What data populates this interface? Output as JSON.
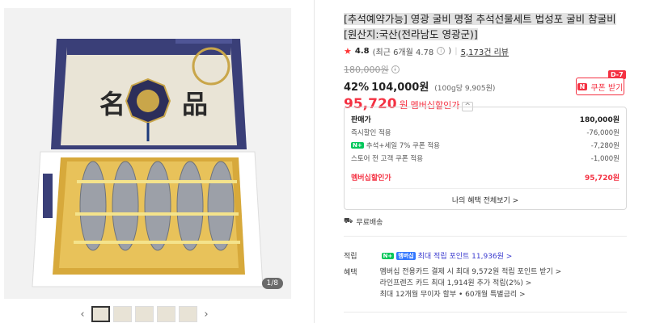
{
  "product": {
    "title": "[추석예약가능] 영광 굴비 명절 추석선물세트 법성포 굴비 참굴비 [원산지:국산(전라남도 영광군)]",
    "rating": "4.8",
    "rating_detail": "(최근 6개월 4.78",
    "rating_info": "i",
    "rating_close": ")",
    "review_count": "5,173건 리뷰",
    "original_price": "180,000원",
    "discount_percent": "42%",
    "discount_price": "104,000원",
    "unit_price": "(100g당 9,905원)",
    "member_price": "95,720",
    "member_won": "원",
    "member_label": "멤버십할인가",
    "image_counter": "1/8"
  },
  "coupon": {
    "badge": "D-7",
    "logo": "N",
    "label": "쿠폰 받기"
  },
  "breakdown": {
    "rows": [
      {
        "label": "판매가",
        "value": "180,000원"
      },
      {
        "label": "즉시할인 적용",
        "value": "-76,000원"
      },
      {
        "label": "추석+세일 7% 쿠폰 적용",
        "value": "-7,280원",
        "badge": "N+"
      },
      {
        "label": "스토어 전 고객 쿠폰 적용",
        "value": "-1,000원"
      },
      {
        "label": "멤버십할인가",
        "value": "95,720원"
      }
    ],
    "link": "나의 혜택 전체보기 >"
  },
  "shipping": {
    "label": "무료배송"
  },
  "points": {
    "label": "적립",
    "badge": "N+",
    "badge2": "멤버십",
    "value": "최대 적립 포인트 11,936원 >"
  },
  "benefits": {
    "label": "혜택",
    "items": [
      "멤버십 전용카드 결제 시 최대 9,572원 적립 포인트 받기 >",
      "라인프렌즈 카드 최대 1,914원 추가 적립(2%) >",
      "최대 12개월 무이자 할부 • 60개월 특별금리 >"
    ]
  },
  "thumbnails": {
    "prev": "‹",
    "next": "›"
  }
}
